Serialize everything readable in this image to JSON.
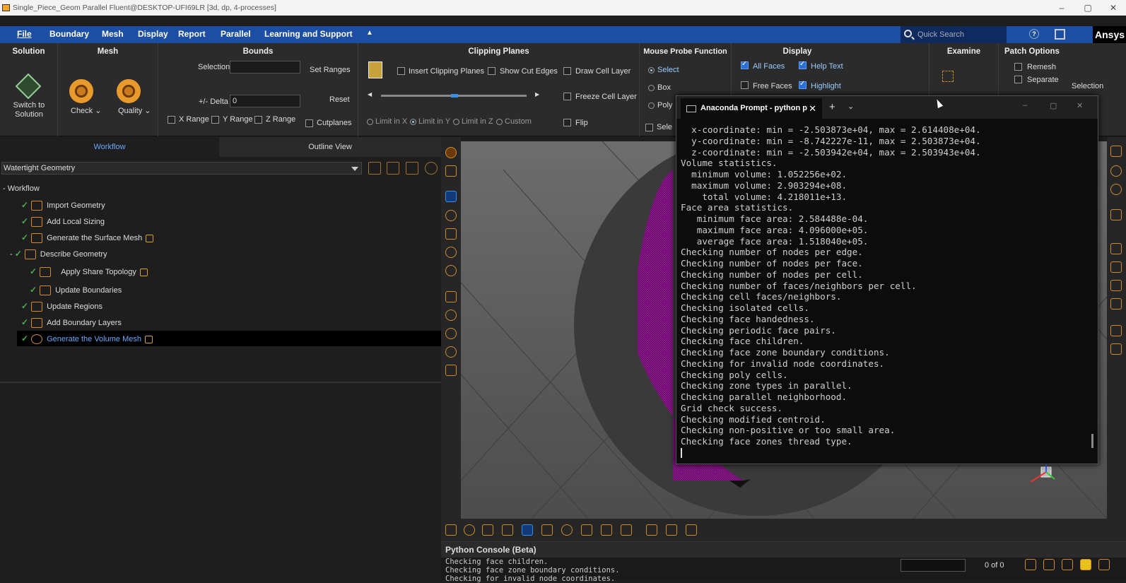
{
  "window": {
    "title": "Single_Piece_Geom Parallel Fluent@DESKTOP-UFI69LR  [3d, dp, 4-processes]"
  },
  "menubar": {
    "items": [
      "File",
      "Boundary",
      "Mesh",
      "Display",
      "Report",
      "Parallel",
      "Learning and Support"
    ],
    "quick_search": "Quick Search",
    "brand": "Ansys"
  },
  "ribbon": {
    "solution": {
      "title": "Solution",
      "btn": "Switch to\nSolution"
    },
    "mesh": {
      "title": "Mesh",
      "check": "Check",
      "quality": "Quality"
    },
    "bounds": {
      "title": "Bounds",
      "selection_label": "Selection",
      "set_ranges": "Set Ranges",
      "delta_label": "+/- Delta",
      "delta_value": "0",
      "reset": "Reset",
      "x_range": "X Range",
      "y_range": "Y Range",
      "z_range": "Z Range",
      "cutplanes": "Cutplanes"
    },
    "clipping": {
      "title": "Clipping Planes",
      "insert": "Insert Clipping Planes",
      "show_cut_edges": "Show Cut Edges",
      "draw_cell_layer": "Draw Cell Layer",
      "freeze_cell_layer": "Freeze Cell Layer",
      "flip": "Flip",
      "limit_x": "Limit in X",
      "limit_y": "Limit in Y",
      "limit_z": "Limit in Z",
      "custom": "Custom"
    },
    "probe": {
      "title": "Mouse Probe Function",
      "select": "Select",
      "box": "Box",
      "poly": "Poly",
      "sele": "Sele"
    },
    "display": {
      "title": "Display",
      "all_faces": "All Faces",
      "help_text": "Help Text",
      "free_faces": "Free Faces",
      "highlight": "Highlight"
    },
    "examine": {
      "title": "Examine"
    },
    "patch": {
      "title": "Patch Options",
      "remesh": "Remesh",
      "separate": "Separate",
      "selection": "Selection"
    }
  },
  "left": {
    "tabs": [
      "Workflow",
      "Outline View"
    ],
    "dropdown": "Watertight Geometry",
    "root": "Workflow",
    "tasks": [
      "Import Geometry",
      "Add Local Sizing",
      "Generate the Surface Mesh",
      "Describe Geometry",
      "Apply Share Topology",
      "Update Boundaries",
      "Update Regions",
      "Add Boundary Layers",
      "Generate the Volume Mesh"
    ]
  },
  "prompt": {
    "tab": "Anaconda Prompt - python  p",
    "lines": [
      "  x-coordinate: min = -2.503873e+04, max = 2.614408e+04.",
      "  y-coordinate: min = -8.742227e-11, max = 2.503873e+04.",
      "  z-coordinate: min = -2.503942e+04, max = 2.503943e+04.",
      "Volume statistics.",
      "  minimum volume: 1.052256e+02.",
      "  maximum volume: 2.903294e+08.",
      "    total volume: 4.218011e+13.",
      "Face area statistics.",
      "   minimum face area: 2.584488e-04.",
      "   maximum face area: 4.096000e+05.",
      "   average face area: 1.518040e+05.",
      "Checking number of nodes per edge.",
      "Checking number of nodes per face.",
      "Checking number of nodes per cell.",
      "Checking number of faces/neighbors per cell.",
      "Checking cell faces/neighbors.",
      "Checking isolated cells.",
      "Checking face handedness.",
      "Checking periodic face pairs.",
      "Checking face children.",
      "Checking face zone boundary conditions.",
      "Checking for invalid node coordinates.",
      "Checking poly cells.",
      "Checking zone types in parallel.",
      "Checking parallel neighborhood.",
      "Grid check success.",
      "Checking modified centroid.",
      "Checking non-positive or too small area.",
      "Checking face zones thread type."
    ]
  },
  "console": {
    "title": "Python Console (Beta)",
    "lines": [
      "Checking face children.",
      "Checking face zone boundary conditions.",
      "Checking for invalid node coordinates."
    ],
    "count": "0 of 0"
  }
}
